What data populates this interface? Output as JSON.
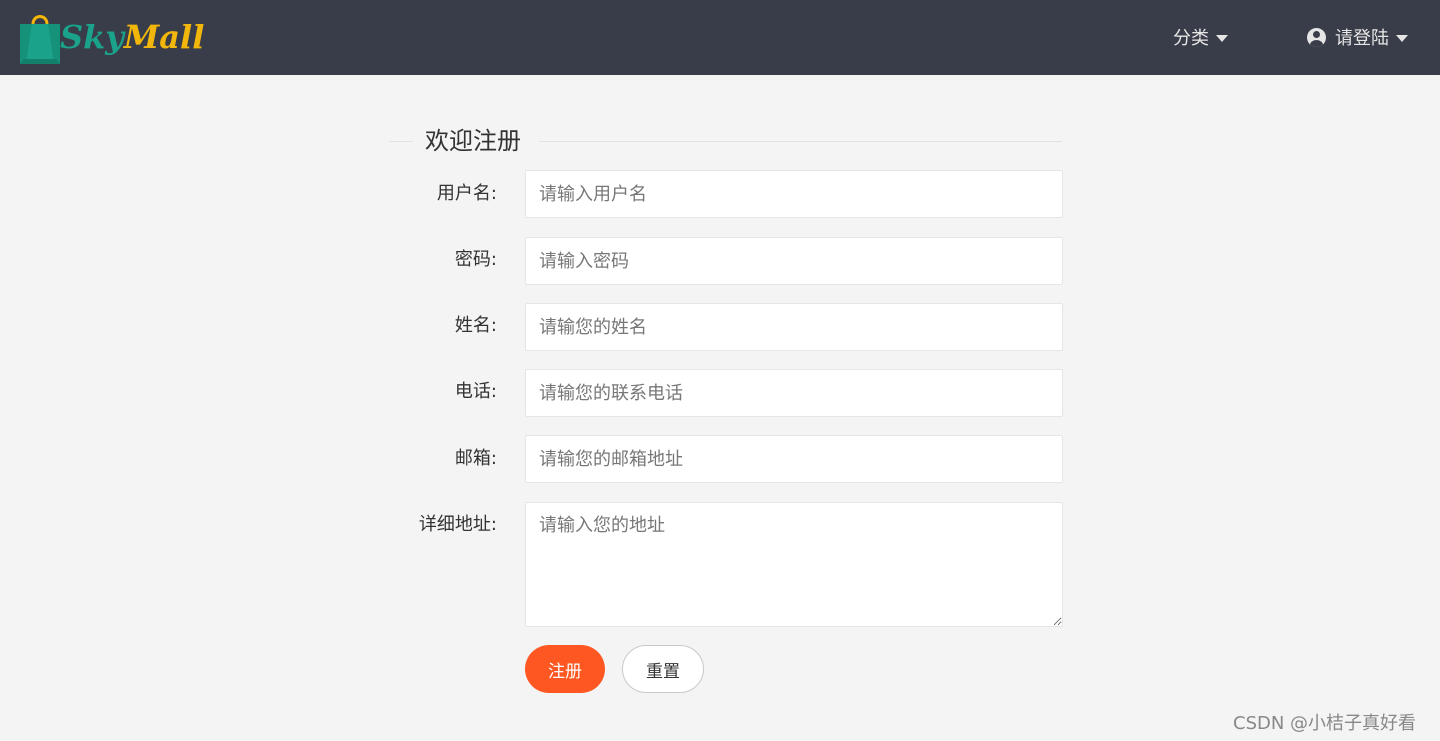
{
  "header": {
    "logo": {
      "part1": "Sky",
      "part2": "Mall"
    },
    "nav": {
      "category_label": "分类",
      "login_label": "请登陆"
    }
  },
  "form": {
    "title": "欢迎注册",
    "fields": [
      {
        "label": "用户名:",
        "placeholder": "请输入用户名"
      },
      {
        "label": "密码:",
        "placeholder": "请输入密码"
      },
      {
        "label": "姓名:",
        "placeholder": "请输您的姓名"
      },
      {
        "label": "电话:",
        "placeholder": "请输您的联系电话"
      },
      {
        "label": "邮箱:",
        "placeholder": "请输您的邮箱地址"
      },
      {
        "label": "详细地址:",
        "placeholder": "请输入您的地址"
      }
    ],
    "submit_label": "注册",
    "reset_label": "重置"
  },
  "watermark": "CSDN @小桔子真好看",
  "colors": {
    "header_bg": "#393d49",
    "page_bg": "#f4f4f4",
    "primary_button": "#ff5722",
    "logo_green": "#1aa38a",
    "logo_yellow": "#f2b70a"
  }
}
